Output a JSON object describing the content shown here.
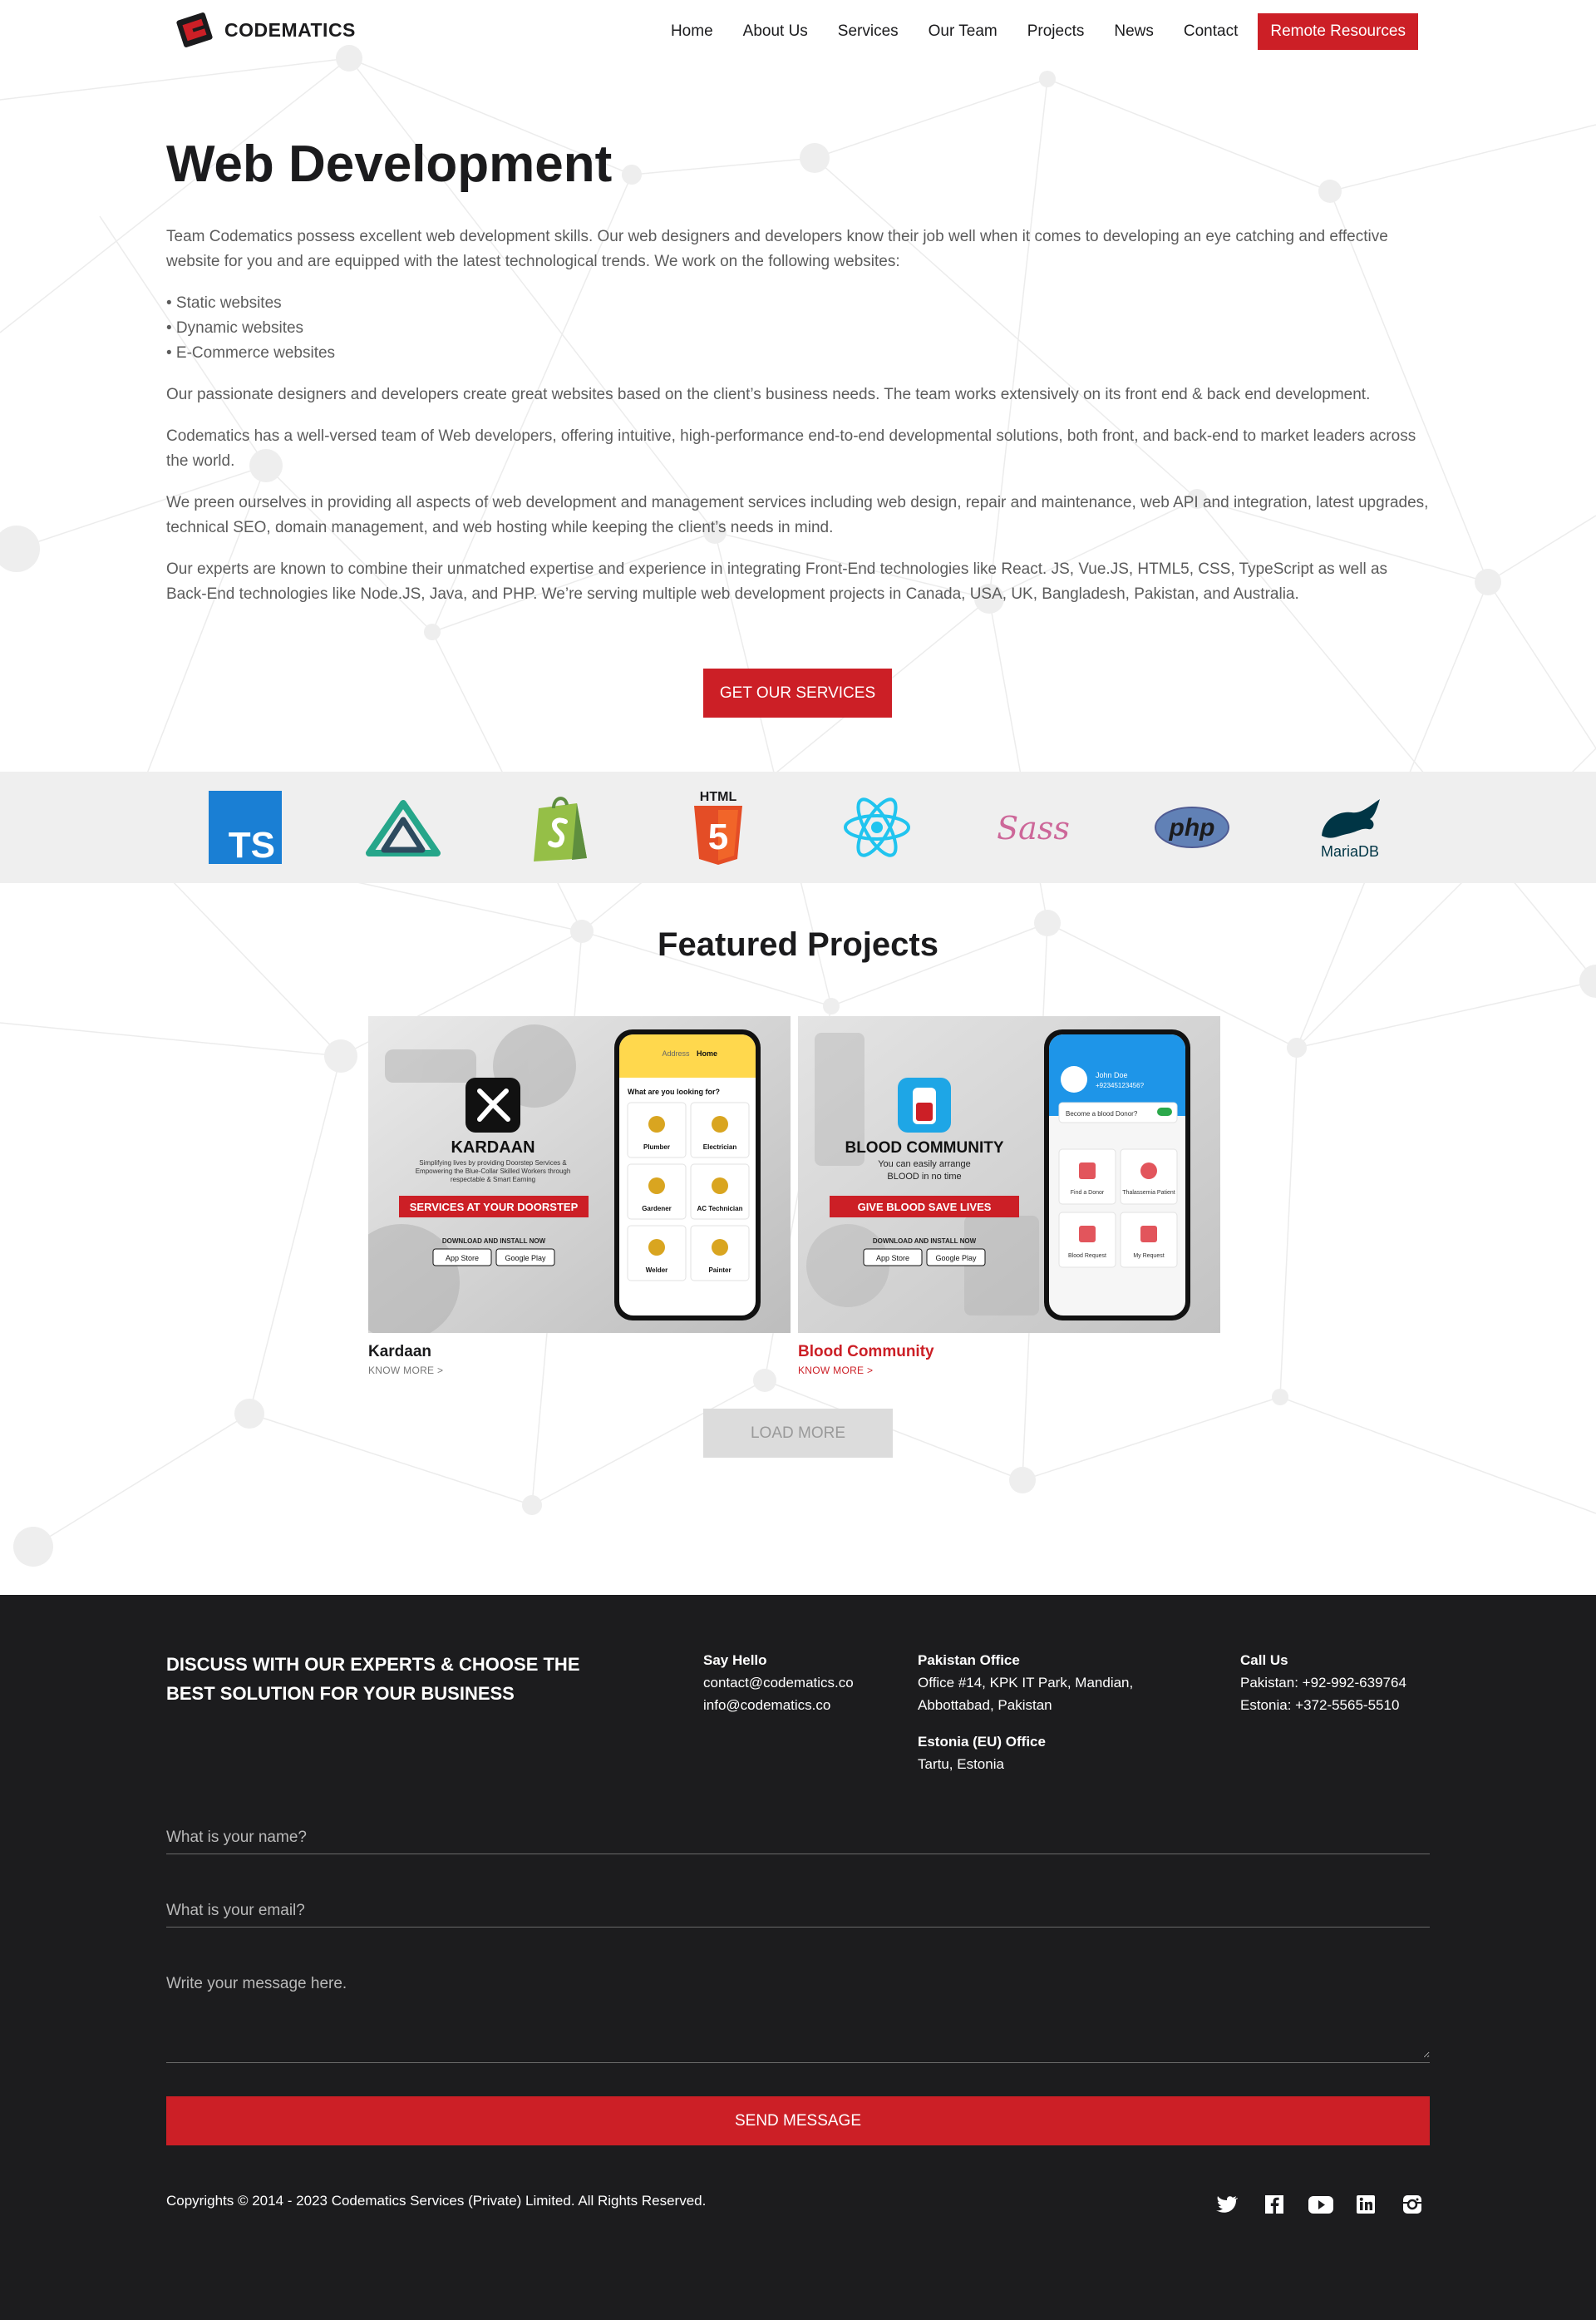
{
  "brand": {
    "name": "CODEMATICS",
    "accent": "#cc1f26",
    "dark": "#1c1c1e"
  },
  "nav": {
    "items": [
      "Home",
      "About Us",
      "Services",
      "Our Team",
      "Projects",
      "News",
      "Contact"
    ],
    "cta": "Remote Resources"
  },
  "main": {
    "title": "Web Development",
    "intro": "Team Codematics possess excellent web development skills. Our web designers and developers know their job well when it comes to developing an eye catching and effective website for you and are equipped with the latest technological trends. We work on the following websites:",
    "bullets": [
      "• Static websites",
      "• Dynamic websites",
      "• E-Commerce websites"
    ],
    "paragraphs": [
      "Our passionate designers and developers create great websites based on the client’s business needs. The team works extensively on its front end & back end development.",
      "Codematics has a well-versed team of Web developers, offering intuitive, high-performance end-to-end developmental solutions, both front, and back-end to market leaders across the world.",
      "We preen ourselves in providing all aspects of web development and management services including web design, repair and maintenance, web API and integration, latest upgrades, technical SEO, domain management, and web hosting while keeping the client’s needs in mind.",
      "Our experts are known to combine their unmatched expertise and experience in integrating Front-End technologies like React. JS, Vue.JS, HTML5, CSS, TypeScript as well as Back-End technologies like Node.JS, Java, and PHP. We’re serving multiple web development projects in Canada, USA, UK, Bangladesh, Pakistan, and Australia."
    ],
    "cta": "GET OUR SERVICES"
  },
  "tech": {
    "logos": [
      "typescript-logo",
      "nuxt-logo",
      "shopify-logo",
      "html5-logo",
      "react-logo",
      "sass-logo",
      "php-logo",
      "mariadb-logo"
    ],
    "ts_text": "TS",
    "html_text": "HTML",
    "html5_num": "5",
    "sass_text": "Sass",
    "php_text": "php",
    "mariadb_text": "MariaDB"
  },
  "featured": {
    "title": "Featured Projects",
    "projects": [
      {
        "name": "Kardaan",
        "more": "KNOW MORE >",
        "img_title": "KARDAAN",
        "img_tagline": "Simplifying lives by providing Doorstep Services & Empowering the Blue-Collar Skilled Workers through respectable & Smart Earning",
        "img_banner": "SERVICES AT YOUR DOORSTEP",
        "img_download": "DOWNLOAD AND INSTALL NOW",
        "app_store": "App Store",
        "google_play": "Google Play",
        "phone_header_label": "Address",
        "phone_header_value": "Home",
        "phone_question": "What are you looking for?",
        "phone_tiles": [
          "Plumber",
          "Electrician",
          "Gardener",
          "AC Technician",
          "Welder",
          "Painter"
        ]
      },
      {
        "name": "Blood Community",
        "more": "KNOW MORE >",
        "img_title": "BLOOD COMMUNITY",
        "img_sub_1": "You can easily arrange",
        "img_sub_2": "BLOOD in no time",
        "img_banner": "GIVE BLOOD SAVE LIVES",
        "img_download": "DOWNLOAD AND INSTALL NOW",
        "app_store": "App Store",
        "google_play": "Google Play",
        "phone_user": "John Doe",
        "phone_number": "+92345123456?",
        "phone_toggle": "Become a blood Donor?",
        "phone_tiles": [
          "Find a Donor",
          "Thalassemia Patient",
          "Blood Request",
          "My Request"
        ]
      }
    ],
    "load_more": "LOAD MORE"
  },
  "footer": {
    "heading": "DISCUSS WITH OUR EXPERTS & CHOOSE THE BEST SOLUTION FOR YOUR BUSINESS",
    "say_hello": {
      "title": "Say Hello",
      "lines": [
        "contact@codematics.co",
        "info@codematics.co"
      ]
    },
    "pakistan": {
      "title": "Pakistan Office",
      "lines": [
        "Office #14, KPK IT Park, Mandian,",
        "Abbottabad, Pakistan"
      ]
    },
    "estonia": {
      "title": "Estonia (EU) Office",
      "lines": [
        "Tartu, Estonia"
      ]
    },
    "call": {
      "title": "Call Us",
      "lines": [
        "Pakistan: +92-992-639764",
        "Estonia: +372-5565-5510"
      ]
    },
    "form": {
      "name_placeholder": "What is your name?",
      "email_placeholder": "What is your email?",
      "message_placeholder": "Write your message here.",
      "send": "SEND MESSAGE"
    },
    "copyright": "Copyrights © 2014 - 2023 Codematics Services (Private) Limited. All Rights Reserved.",
    "social": [
      "twitter-icon",
      "facebook-icon",
      "youtube-icon",
      "linkedin-icon",
      "instagram-icon"
    ]
  }
}
